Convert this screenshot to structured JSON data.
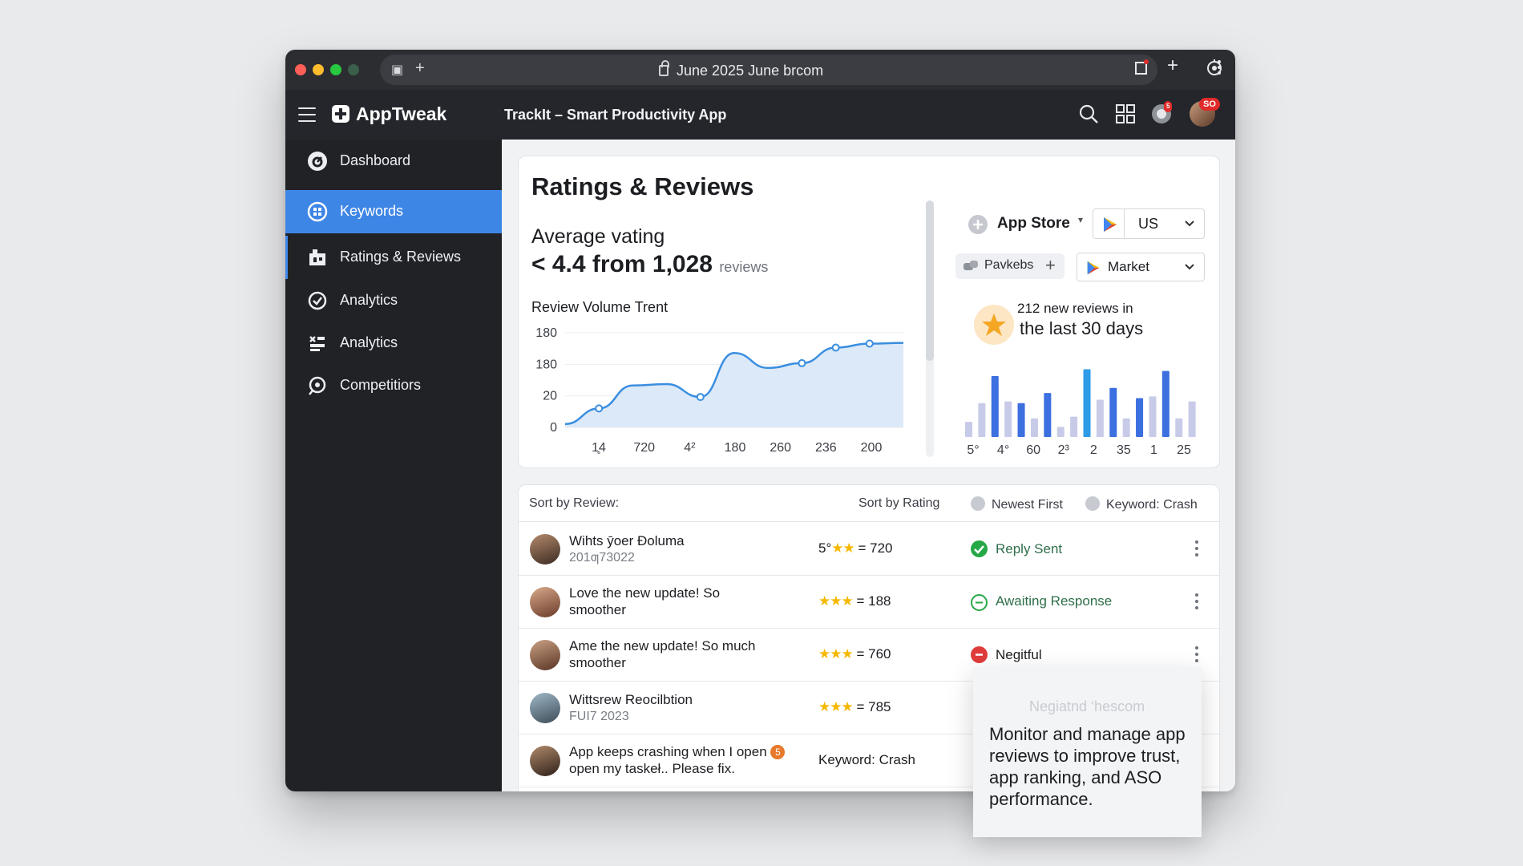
{
  "browser": {
    "url": "June 2025  June brcom",
    "colors": {
      "close": "#ff5f57",
      "minimize": "#febc2e",
      "zoom": "#28c840"
    }
  },
  "app": {
    "brand": "AppTweak",
    "title": "TrackIt – Smart Productivity App",
    "header_badges": {
      "notifications": "5",
      "profile": "SO"
    },
    "accent": "#3e86e6"
  },
  "sidebar": {
    "items": [
      {
        "label": "Dashboard",
        "icon": "dashboard-icon"
      },
      {
        "label": "Keywords",
        "icon": "keywords-icon",
        "active": true
      },
      {
        "label": "Ratings & Reviews",
        "icon": "ratings-icon"
      },
      {
        "label": "Analytics",
        "icon": "analytics-icon"
      },
      {
        "label": "Analytics",
        "icon": "analytics-alt-icon"
      },
      {
        "label": "Competitiors",
        "icon": "competitors-icon"
      }
    ]
  },
  "ratings": {
    "heading": "Ratings & Reviews",
    "avg_label": "Average vating",
    "avg_value": "< 4.4 from 1,028",
    "avg_unit": "reviews",
    "chart_title": "Review Volume Trent",
    "store_label": "App Store",
    "country": "US",
    "filter_chip": "Pavkebs",
    "market": "Market",
    "new_reviews_line1": "212 new reviews in",
    "new_reviews_line2": "the last 30 days"
  },
  "chart_data": [
    {
      "type": "area",
      "title": "Review Volume Trent",
      "y_tick_labels": [
        "180",
        "180",
        "20",
        "0"
      ],
      "x_tick_labels": [
        "1̥4",
        "720",
        "4²",
        "180",
        "260",
        "236",
        "200"
      ],
      "x": [
        0,
        1,
        2,
        3,
        4,
        5,
        6,
        7,
        8,
        9,
        10
      ],
      "values": [
        5,
        28,
        62,
        64,
        45,
        110,
        88,
        95,
        118,
        124,
        125
      ],
      "ylim": [
        0,
        140
      ],
      "markers_at": [
        1,
        4,
        7,
        8,
        9
      ],
      "color": "#3a8ee0",
      "grid": true
    },
    {
      "type": "bar",
      "x_tick_labels": [
        "5°",
        "4°",
        "60",
        "2³",
        "2",
        "35",
        "1",
        "25"
      ],
      "values": [
        18,
        40,
        72,
        42,
        40,
        22,
        52,
        12,
        24,
        80,
        44,
        58,
        22,
        46,
        48,
        78,
        22,
        42
      ],
      "highlight": [
        false,
        false,
        true,
        false,
        true,
        false,
        true,
        false,
        false,
        true,
        false,
        true,
        false,
        true,
        false,
        true,
        false,
        false
      ],
      "colors": {
        "highlight": "#3c6fe0",
        "bright": "#2e9be8",
        "muted": "#c8cbe8"
      },
      "ylim": [
        0,
        90
      ]
    }
  ],
  "reviews": {
    "sort_label": "Sort by Review:",
    "sort_rating": "Sort by Rating",
    "newest": "Newest First",
    "keyword": "Keyword: Crash",
    "rows": [
      {
        "title": "Wihts ȳoer Ðoluma",
        "sub": "201ƣ73022",
        "rating": "5°",
        "stars": "★★",
        "count": "= 720",
        "status": "Reply Sent",
        "status_kind": "success"
      },
      {
        "title": "Love the new update! So",
        "sub": "smoother",
        "rating": "",
        "stars": "★★★",
        "count": "= 188",
        "status": "Awaiting Response",
        "status_kind": "pending"
      },
      {
        "title": "Ame the new update! So much",
        "sub": "smoother",
        "rating": "",
        "stars": "★★★",
        "count": "= 760",
        "status": "Negitful",
        "status_kind": "negative"
      },
      {
        "title": "Wittѕrew Reocilbtion",
        "sub": "FUI7 2023",
        "rating": "",
        "stars": "★★★",
        "count": "= 785",
        "status": "Negiatnd ‘hescom",
        "status_kind": "ghost"
      },
      {
        "title": "App keeps crashing when I open",
        "sub": "open my taskeł.. Please fix.",
        "rating": "Keyword: Crash",
        "stars": "",
        "count": "",
        "status": "",
        "status_kind": "none",
        "warn": "5"
      }
    ]
  },
  "tooltip": {
    "text": "Monitor and manage app reviews to improve trust, app ranking, and ASO performance."
  }
}
